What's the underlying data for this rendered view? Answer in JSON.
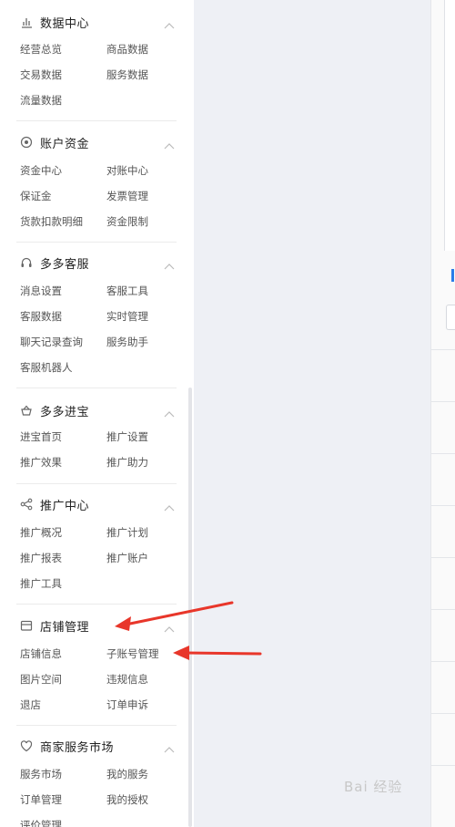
{
  "sections": [
    {
      "id": "data",
      "icon": "bar-chart-icon",
      "title": "数据中心",
      "items": [
        "经营总览",
        "商品数据",
        "交易数据",
        "服务数据",
        "流量数据"
      ]
    },
    {
      "id": "funds",
      "icon": "coin-icon",
      "title": "账户资金",
      "items": [
        "资金中心",
        "对账中心",
        "保证金",
        "发票管理",
        "货款扣款明细",
        "资金限制"
      ]
    },
    {
      "id": "service",
      "icon": "headset-icon",
      "title": "多多客服",
      "items": [
        "消息设置",
        "客服工具",
        "客服数据",
        "实时管理",
        "聊天记录查询",
        "服务助手",
        "客服机器人"
      ]
    },
    {
      "id": "jinbao",
      "icon": "treasure-icon",
      "title": "多多进宝",
      "items": [
        "进宝首页",
        "推广设置",
        "推广效果",
        "推广助力"
      ]
    },
    {
      "id": "promo",
      "icon": "share-icon",
      "title": "推广中心",
      "items": [
        "推广概况",
        "推广计划",
        "推广报表",
        "推广账户",
        "推广工具"
      ]
    },
    {
      "id": "store",
      "icon": "store-icon",
      "title": "店铺管理",
      "items": [
        "店铺信息",
        "子账号管理",
        "图片空间",
        "违规信息",
        "退店",
        "订单申诉"
      ]
    },
    {
      "id": "market",
      "icon": "heart-icon",
      "title": "商家服务市场",
      "items": [
        "服务市场",
        "我的服务",
        "订单管理",
        "我的授权",
        "评价管理"
      ]
    }
  ],
  "watermark": "Bai 经验",
  "colors": {
    "arrow": "#e8362a",
    "accent": "#2b7de9"
  }
}
